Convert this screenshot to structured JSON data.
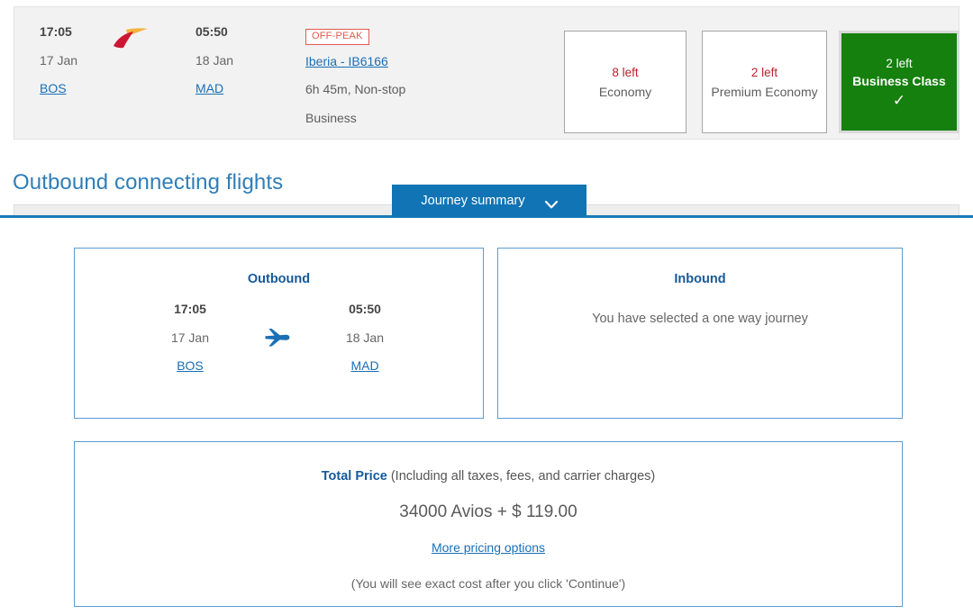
{
  "flight_card": {
    "departure": {
      "time": "17:05",
      "date": "17 Jan",
      "airport": "BOS"
    },
    "arrival": {
      "time": "05:50",
      "date": "18 Jan",
      "airport": "MAD"
    },
    "airline_logo": "iberia-logo",
    "badge": "OFF-PEAK",
    "carrier": "Iberia - IB6166",
    "duration": "6h 45m, Non-stop",
    "cabin": "Business",
    "cabin_options": [
      {
        "seats": "8 left",
        "name": "Economy",
        "selected": false
      },
      {
        "seats": "2 left",
        "name": "Premium Economy",
        "selected": false
      },
      {
        "seats": "2 left",
        "name": "Business Class",
        "selected": true
      }
    ]
  },
  "section": {
    "heading": "Outbound connecting flights"
  },
  "journey_tab": {
    "label": "Journey summary",
    "chevron": "chevron-down-icon"
  },
  "summary": {
    "outbound": {
      "title": "Outbound",
      "departure": {
        "time": "17:05",
        "date": "17 Jan",
        "airport": "BOS"
      },
      "arrival": {
        "time": "05:50",
        "date": "18 Jan",
        "airport": "MAD"
      },
      "plane_icon": "airplane-icon"
    },
    "inbound": {
      "title": "Inbound",
      "message": "You have selected a one way journey"
    }
  },
  "price": {
    "label_strong": "Total Price",
    "label_rest": " (Including all taxes, fees, and carrier charges)",
    "amount": "34000 Avios + $ 119.00",
    "more_options_link": "More pricing options",
    "note": "(You will see exact cost after you click 'Continue')"
  },
  "colors": {
    "brand_blue": "#1174b5",
    "heading_blue": "#2e7eb8",
    "link_blue": "#1a6fb5",
    "selected_green": "#15800e",
    "alert_red": "#b9222b",
    "badge_red": "#e0594e"
  }
}
